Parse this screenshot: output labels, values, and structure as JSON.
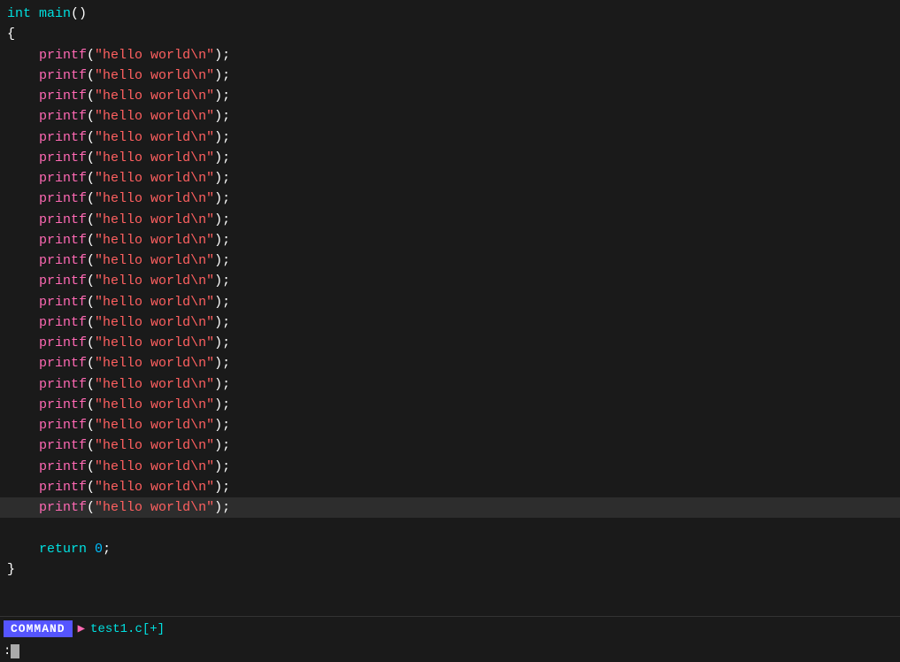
{
  "editor": {
    "background": "#1a1a1a",
    "lines": [
      {
        "id": 1,
        "content": "int main()",
        "type": "func_decl"
      },
      {
        "id": 2,
        "content": "{",
        "type": "brace"
      },
      {
        "id": 3,
        "content": "    printf(\"hello world\\n\");",
        "type": "printf"
      },
      {
        "id": 4,
        "content": "    printf(\"hello world\\n\");",
        "type": "printf"
      },
      {
        "id": 5,
        "content": "    printf(\"hello world\\n\");",
        "type": "printf"
      },
      {
        "id": 6,
        "content": "    printf(\"hello world\\n\");",
        "type": "printf"
      },
      {
        "id": 7,
        "content": "    printf(\"hello world\\n\");",
        "type": "printf"
      },
      {
        "id": 8,
        "content": "    printf(\"hello world\\n\");",
        "type": "printf"
      },
      {
        "id": 9,
        "content": "    printf(\"hello world\\n\");",
        "type": "printf"
      },
      {
        "id": 10,
        "content": "    printf(\"hello world\\n\");",
        "type": "printf"
      },
      {
        "id": 11,
        "content": "    printf(\"hello world\\n\");",
        "type": "printf"
      },
      {
        "id": 12,
        "content": "    printf(\"hello world\\n\");",
        "type": "printf"
      },
      {
        "id": 13,
        "content": "    printf(\"hello world\\n\");",
        "type": "printf"
      },
      {
        "id": 14,
        "content": "    printf(\"hello world\\n\");",
        "type": "printf"
      },
      {
        "id": 15,
        "content": "    printf(\"hello world\\n\");",
        "type": "printf"
      },
      {
        "id": 16,
        "content": "    printf(\"hello world\\n\");",
        "type": "printf"
      },
      {
        "id": 17,
        "content": "    printf(\"hello world\\n\");",
        "type": "printf"
      },
      {
        "id": 18,
        "content": "    printf(\"hello world\\n\");",
        "type": "printf"
      },
      {
        "id": 19,
        "content": "    printf(\"hello world\\n\");",
        "type": "printf"
      },
      {
        "id": 20,
        "content": "    printf(\"hello world\\n\");",
        "type": "printf"
      },
      {
        "id": 21,
        "content": "    printf(\"hello world\\n\");",
        "type": "printf"
      },
      {
        "id": 22,
        "content": "    printf(\"hello world\\n\");",
        "type": "printf"
      },
      {
        "id": 23,
        "content": "    printf(\"hello world\\n\");",
        "type": "printf"
      },
      {
        "id": 24,
        "content": "    printf(\"hello world\\n\");",
        "type": "printf"
      },
      {
        "id": 25,
        "content": "    printf(\"hello world\\n\");",
        "type": "printf",
        "highlighted": true
      },
      {
        "id": 26,
        "content": "",
        "type": "empty"
      },
      {
        "id": 27,
        "content": "    return 0;",
        "type": "return"
      },
      {
        "id": 28,
        "content": "}",
        "type": "brace"
      }
    ]
  },
  "statusbar": {
    "mode_label": "COMMAND",
    "arrow": "▶",
    "filename": "test1.c[+]"
  },
  "commandline": {
    "prompt": ":",
    "cursor": ""
  }
}
